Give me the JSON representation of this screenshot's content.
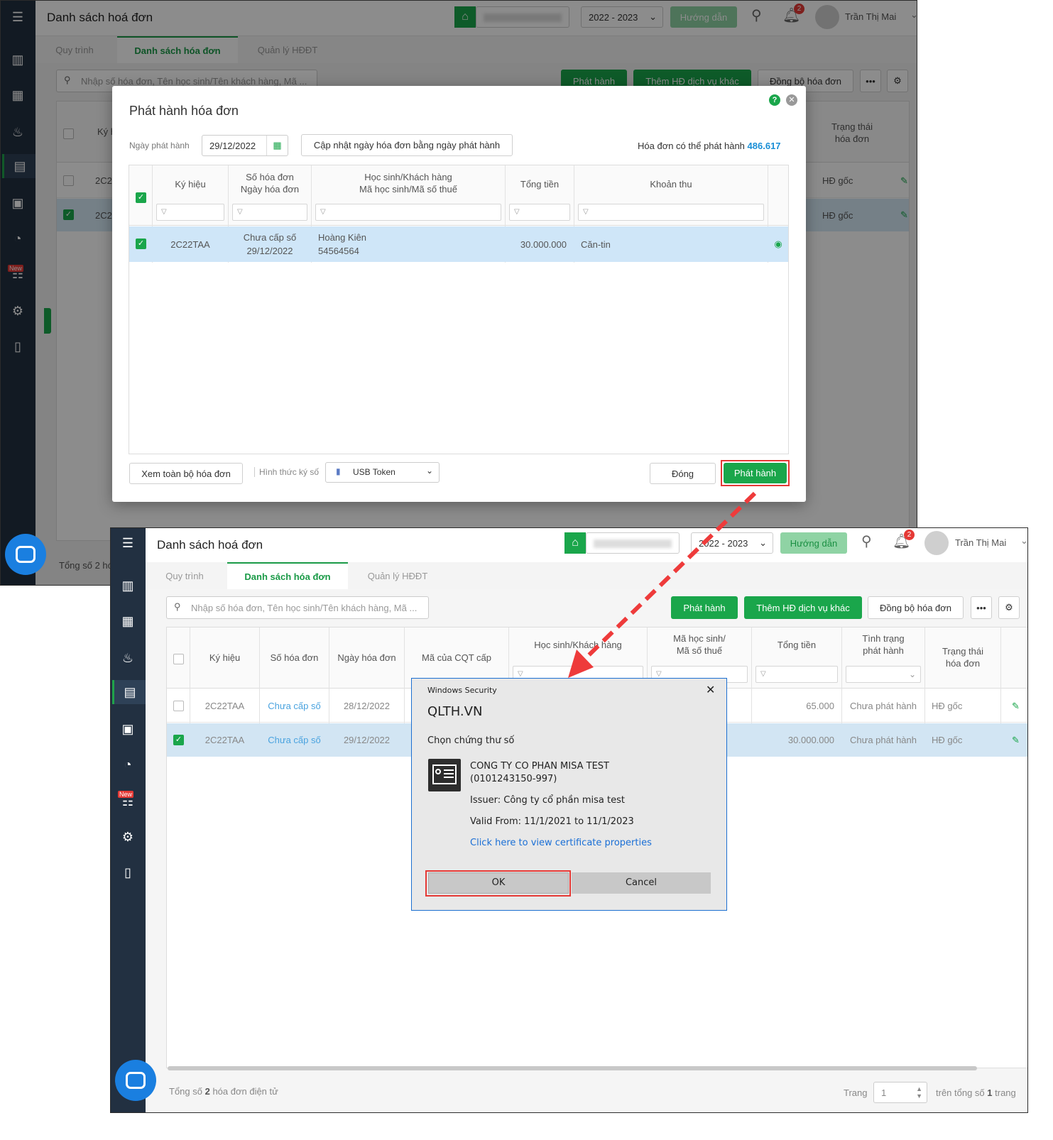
{
  "top": {
    "page_title": "Danh sách hoá đơn",
    "year": "2022 - 2023",
    "guide_btn": "Hướng dẫn",
    "notif_count": "2",
    "user_name": "Trần Thị Mai",
    "tabs": [
      "Quy trình",
      "Danh sách hóa đơn",
      "Quản lý HĐĐT"
    ],
    "search_placeholder": "Nhập số hóa đơn, Tên học sinh/Tên khách hàng, Mã ...",
    "btn_issue": "Phát hành",
    "btn_add": "Thêm HĐ dịch vụ khác",
    "btn_sync": "Đồng bộ hóa đơn",
    "col_kyhieu_partial": "Ký h",
    "col_status": "Trạng thái\nhóa đơn",
    "rows": [
      {
        "kh": "2C22",
        "status": "HĐ gốc"
      },
      {
        "kh": "2C22",
        "status": "HĐ gốc"
      }
    ],
    "total_partial": "Tổng số 2 hó",
    "new_badge": "New"
  },
  "modal": {
    "title": "Phát hành hóa đơn",
    "date_label": "Ngày phát hành",
    "date_value": "29/12/2022",
    "update_btn": "Cập nhật ngày hóa đơn bằng ngày phát hành",
    "available_label": "Hóa đơn có thể phát hành",
    "available_value": "486.617",
    "cols": [
      "Ký hiệu",
      "Số hóa đơn\nNgày hóa đơn",
      "Học sinh/Khách hàng\nMã học sinh/Mã số thuế",
      "Tổng tiền",
      "Khoản thu"
    ],
    "row": {
      "kyhieu": "2C22TAA",
      "so": "Chưa cấp số",
      "ngay": "29/12/2022",
      "ten": "Hoàng Kiên",
      "ma": "54564564",
      "tong": "30.000.000",
      "khoan": "Căn-tin"
    },
    "view_all_btn": "Xem toàn bộ hóa đơn",
    "sign_label": "Hình thức ký số",
    "sign_value": "USB Token",
    "close_btn": "Đóng",
    "issue_btn": "Phát hành"
  },
  "bottom": {
    "page_title": "Danh sách hoá đơn",
    "year": "2022 - 2023",
    "guide_btn": "Hướng dẫn",
    "notif_count": "2",
    "user_name": "Trần Thị Mai",
    "tabs": [
      "Quy trình",
      "Danh sách hóa đơn",
      "Quản lý HĐĐT"
    ],
    "search_placeholder": "Nhập số hóa đơn, Tên học sinh/Tên khách hàng, Mã ...",
    "btn_issue": "Phát hành",
    "btn_add": "Thêm HĐ dịch vụ khác",
    "btn_sync": "Đồng bộ hóa đơn",
    "cols": [
      "Ký hiệu",
      "Số hóa đơn",
      "Ngày hóa đơn",
      "Mã của CQT cấp",
      "Học sinh/Khách hàng",
      "Mã học sinh/\nMã số thuế",
      "Tổng tiền",
      "Tình trạng\nphát hành",
      "Trạng thái\nhóa đơn"
    ],
    "rows": [
      {
        "kh": "2C22TAA",
        "so": "Chưa cấp số",
        "ngay": "28/12/2022",
        "tong": "65.000",
        "tinh": "Chưa phát hành",
        "tt": "HĐ gốc"
      },
      {
        "kh": "2C22TAA",
        "so": "Chưa cấp số",
        "ngay": "29/12/2022",
        "tong": "30.000.000",
        "tinh": "Chưa phát hành",
        "tt": "HĐ gốc"
      }
    ],
    "total_prefix": "Tổng số ",
    "total_count": "2",
    "total_suffix": " hóa đơn điện tử",
    "page_label": "Trang",
    "page_value": "1",
    "page_total_prefix": "trên tổng số ",
    "page_total": "1",
    "page_total_suffix": " trang",
    "new_badge": "New"
  },
  "security": {
    "window_title": "Windows Security",
    "app": "QLTH.VN",
    "prompt": "Chọn chứng thư số",
    "cert_name": "CONG TY CO PHAN MISA TEST",
    "cert_id": "(0101243150-997)",
    "issuer": "Issuer: Công ty cổ phần misa test",
    "valid": "Valid From: 11/1/2021 to 11/1/2023",
    "link": "Click here to view certificate properties",
    "ok": "OK",
    "cancel": "Cancel"
  },
  "colors": {
    "accent": "#1aa64b",
    "highlight": "#e53935",
    "link": "#1a8fd6"
  }
}
